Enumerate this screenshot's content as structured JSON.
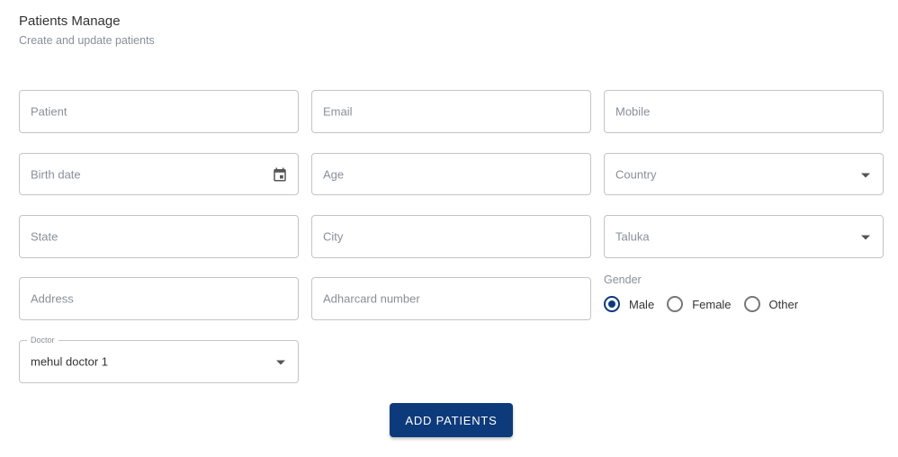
{
  "header": {
    "title": "Patients Manage",
    "subtitle": "Create and update patients"
  },
  "form": {
    "patient": {
      "placeholder": "Patient"
    },
    "email": {
      "placeholder": "Email"
    },
    "mobile": {
      "placeholder": "Mobile"
    },
    "birth_date": {
      "placeholder": "Birth date",
      "icon": "calendar-icon"
    },
    "age": {
      "placeholder": "Age"
    },
    "country": {
      "placeholder": "Country",
      "icon": "chevron-down-icon"
    },
    "state": {
      "placeholder": "State"
    },
    "city": {
      "placeholder": "City"
    },
    "taluka": {
      "placeholder": "Taluka",
      "icon": "chevron-down-icon"
    },
    "address": {
      "placeholder": "Address"
    },
    "adharcard": {
      "placeholder": "Adharcard number"
    },
    "gender": {
      "label": "Gender",
      "options": [
        {
          "label": "Male",
          "checked": true
        },
        {
          "label": "Female",
          "checked": false
        },
        {
          "label": "Other",
          "checked": false
        }
      ]
    },
    "doctor": {
      "label": "Doctor",
      "value": "mehul doctor 1",
      "icon": "chevron-down-icon"
    }
  },
  "actions": {
    "submit_label": "ADD PATIENTS"
  },
  "colors": {
    "primary": "#0d3a7a",
    "border": "#c4c4c4",
    "placeholder": "#8a8f98"
  }
}
